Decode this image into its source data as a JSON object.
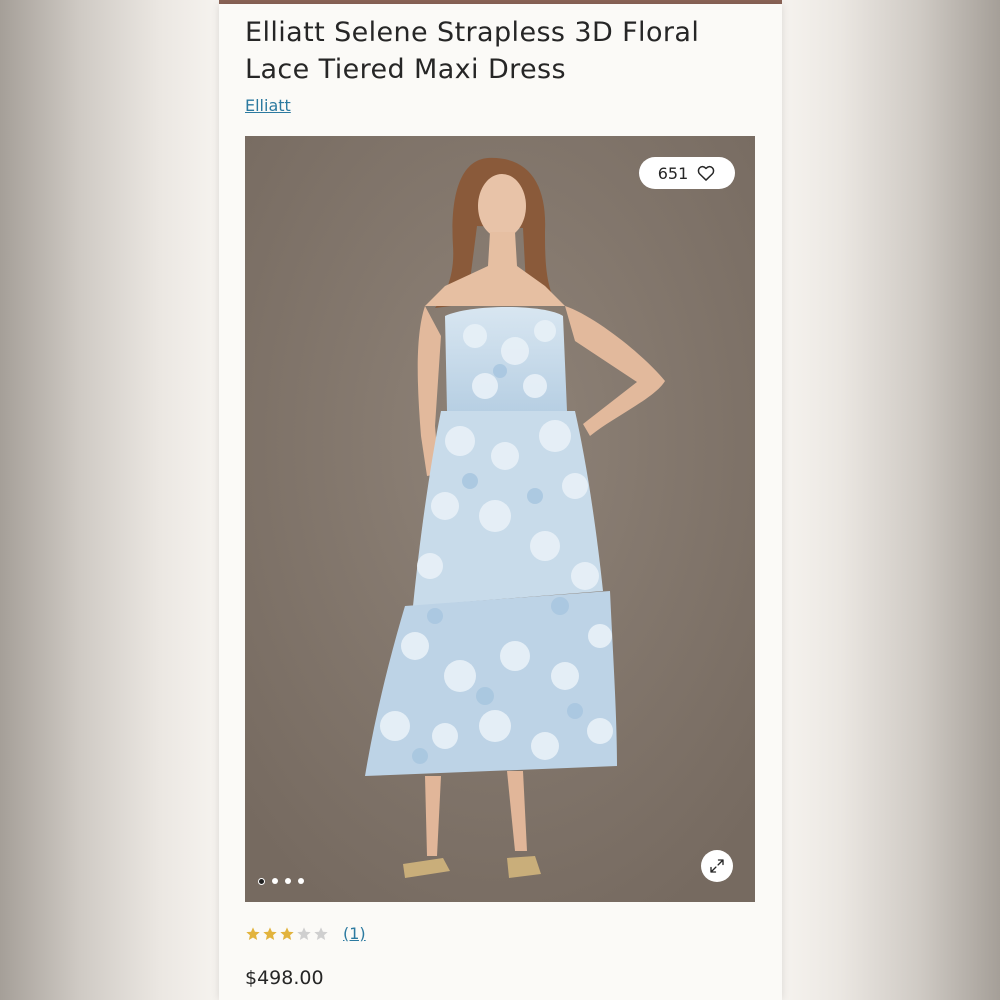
{
  "product": {
    "title": "Elliatt Selene Strapless 3D Floral Lace Tiered Maxi Dress",
    "brand": "Elliatt",
    "price": "$498.00"
  },
  "gallery": {
    "likes": "651",
    "image_count": 4,
    "active_image": 1
  },
  "rating": {
    "stars": 3,
    "max_stars": 5,
    "review_count": "(1)"
  },
  "colors": {
    "accent_link": "#2c7aa0",
    "star_filled": "#e2b33c",
    "star_empty": "#cfcfcf",
    "photo_background": "#877b70"
  },
  "icons": {
    "likes": "heart-icon",
    "expand": "expand-icon",
    "rating": "star-icon"
  }
}
